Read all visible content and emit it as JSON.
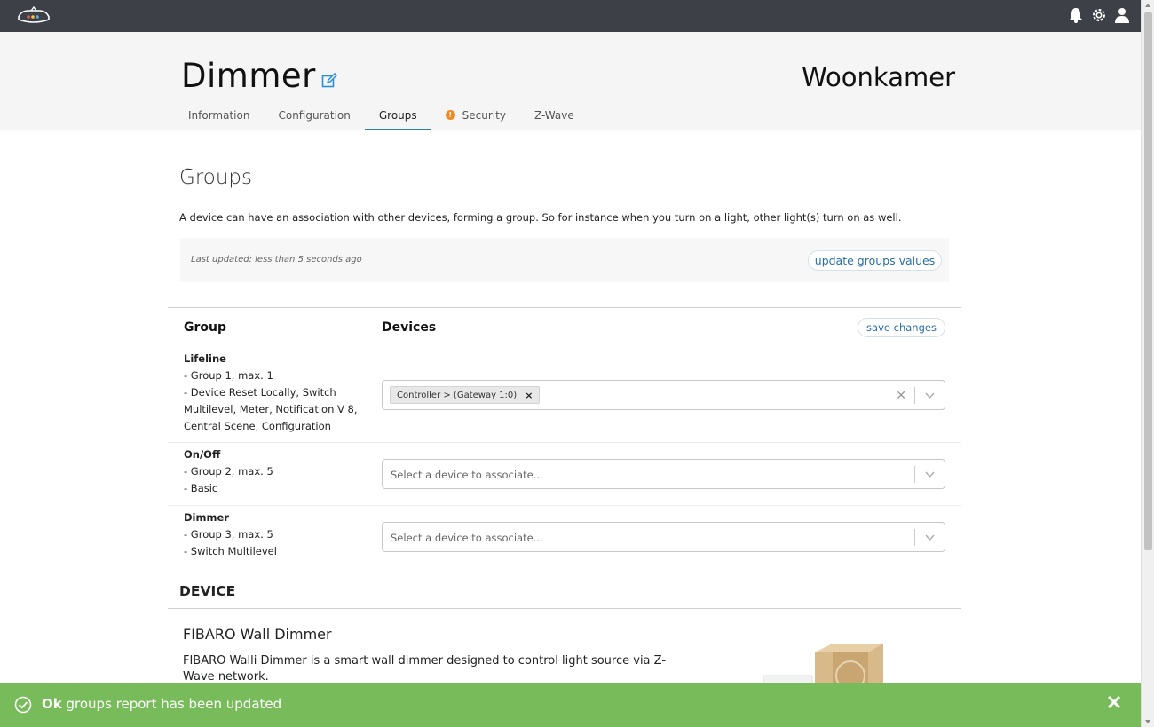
{
  "topbar": {
    "icons": [
      "home-logo-icon",
      "bell-icon",
      "gear-icon",
      "user-icon"
    ]
  },
  "header": {
    "title": "Dimmer",
    "room": "Woonkamer",
    "tabs": [
      {
        "label": "Information"
      },
      {
        "label": "Configuration"
      },
      {
        "label": "Groups",
        "active": true
      },
      {
        "label": "Security",
        "warning": true
      },
      {
        "label": "Z-Wave"
      }
    ]
  },
  "groups": {
    "heading": "Groups",
    "description": "A device can have an association with other devices, forming a group. So for instance when you turn on a light, other light(s) turn on as well.",
    "last_updated": "Last updated: less than 5 seconds ago",
    "update_button": "update groups values",
    "col_group": "Group",
    "col_devices": "Devices",
    "save_button": "save changes",
    "rows": [
      {
        "name": "Lifeline",
        "line1": "- Group 1, max. 1",
        "line2": "- Device Reset Locally, Switch Multilevel, Meter, Notification V 8, Central Scene, Configuration",
        "selected": "Controller > (Gateway 1:0)"
      },
      {
        "name": "On/Off",
        "line1": "- Group 2, max. 5",
        "line2": "- Basic",
        "placeholder": "Select a device to associate..."
      },
      {
        "name": "Dimmer",
        "line1": "- Group 3, max. 5",
        "line2": "- Switch Multilevel",
        "placeholder": "Select a device to associate..."
      }
    ]
  },
  "device": {
    "heading": "DEVICE",
    "name": "FIBARO Wall Dimmer",
    "description": "FIBARO Walli Dimmer is a smart wall dimmer designed to control light source via Z-Wave network."
  },
  "toast": {
    "ok": "Ok",
    "message": "groups report has been updated"
  },
  "colors": {
    "topbar": "#3d4047",
    "accent": "#2b7bb9",
    "toast": "#77bb5a",
    "warning": "#f08a24"
  }
}
